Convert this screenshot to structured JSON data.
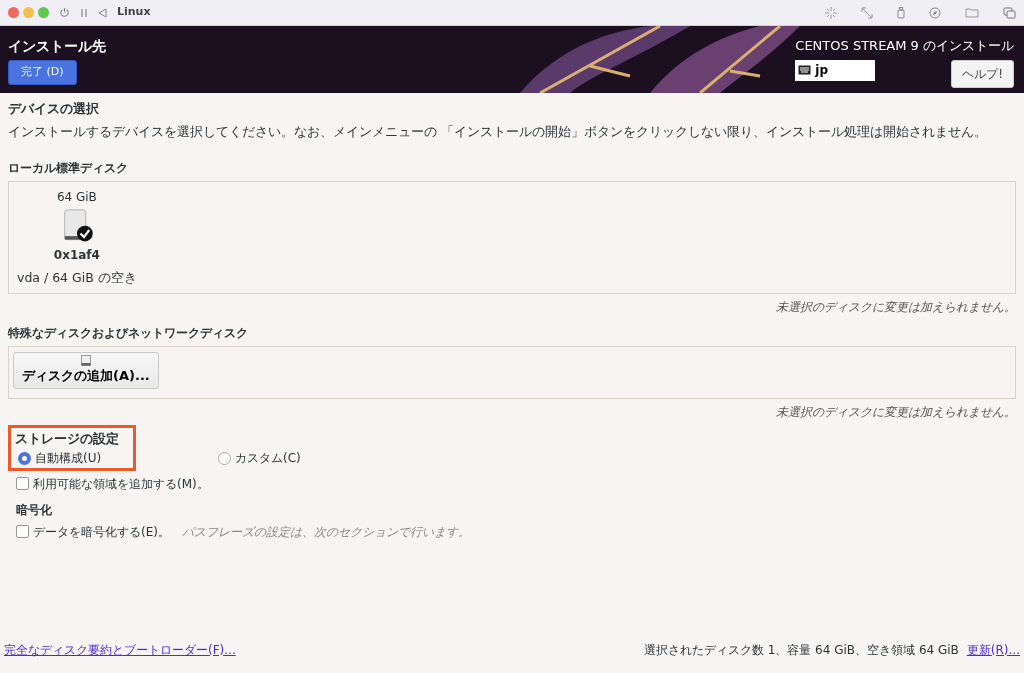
{
  "window": {
    "title": "Linux"
  },
  "header": {
    "title": "インストール先",
    "done_button": "完了 (D)",
    "product": "CENTOS STREAM 9 のインストール",
    "keyboard": "jp",
    "help_button": "ヘルプ!"
  },
  "device_selection": {
    "heading": "デバイスの選択",
    "description": "インストールするデバイスを選択してください。なお、メインメニューの 「インストールの開始」ボタンをクリックしない限り、インストール処理は開始されません。"
  },
  "local_disks": {
    "heading": "ローカル標準ディスク",
    "disks": [
      {
        "size": "64 GiB",
        "name": "0x1af4",
        "detail": "vda / 64 GiB の空き",
        "selected": true
      }
    ],
    "note": "未選択のディスクに変更は加えられません。"
  },
  "special_disks": {
    "heading": "特殊なディスクおよびネットワークディスク",
    "add_button": "ディスクの追加(A)...",
    "note": "未選択のディスクに変更は加えられません。"
  },
  "storage": {
    "heading": "ストレージの設定",
    "options": [
      {
        "label": "自動構成(U)",
        "selected": true
      },
      {
        "label": "カスタム(C)",
        "selected": false
      }
    ],
    "extra_space": {
      "label": "利用可能な領域を追加する(M)。",
      "checked": false
    }
  },
  "encryption": {
    "heading": "暗号化",
    "checkbox": {
      "label": "データを暗号化する(E)。",
      "checked": false
    },
    "hint": "パスフレーズの設定は、次のセクションで行います。"
  },
  "footer": {
    "summary_link": "完全なディスク要約とブートローダー(F)...",
    "status": "選択されたディスク数 1、容量 64 GiB、空き領域 64 GiB",
    "refresh_link": "更新(R)..."
  }
}
